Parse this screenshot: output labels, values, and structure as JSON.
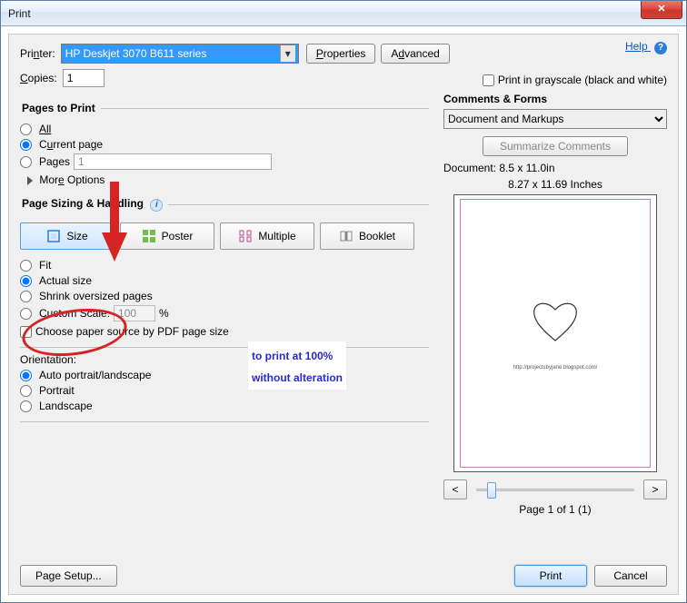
{
  "window": {
    "title": "Print"
  },
  "help": {
    "label": "Help"
  },
  "printer": {
    "label": "Printer:",
    "selected": "HP Deskjet 3070 B611 series",
    "properties_btn": "Properties",
    "advanced_btn": "Advanced"
  },
  "copies": {
    "label": "Copies:",
    "value": "1",
    "grayscale_label": "Print in grayscale (black and white)"
  },
  "pages": {
    "legend": "Pages to Print",
    "all": "All",
    "current": "Current page",
    "range_label": "Pages",
    "range_value": "1",
    "more": "More Options"
  },
  "sizing": {
    "legend": "Page Sizing & Handling",
    "size": "Size",
    "poster": "Poster",
    "multiple": "Multiple",
    "booklet": "Booklet",
    "fit": "Fit",
    "actual": "Actual size",
    "shrink": "Shrink oversized pages",
    "custom": "Custom Scale:",
    "custom_val": "100",
    "percent": "%",
    "paper_source": "Choose paper source by PDF page size"
  },
  "orientation": {
    "legend": "Orientation:",
    "auto": "Auto portrait/landscape",
    "portrait": "Portrait",
    "landscape": "Landscape"
  },
  "comments": {
    "legend": "Comments & Forms",
    "selected": "Document and Markups",
    "summarize": "Summarize Comments"
  },
  "preview": {
    "doc_dims": "Document: 8.5 x 11.0in",
    "page_dims": "8.27 x 11.69 Inches",
    "page_of": "Page 1 of 1 (1)",
    "prev": "<",
    "next": ">"
  },
  "footer": {
    "page_setup": "Page Setup...",
    "print": "Print",
    "cancel": "Cancel"
  },
  "annotation": {
    "line1": "to print at 100%",
    "line2": "without alteration"
  }
}
